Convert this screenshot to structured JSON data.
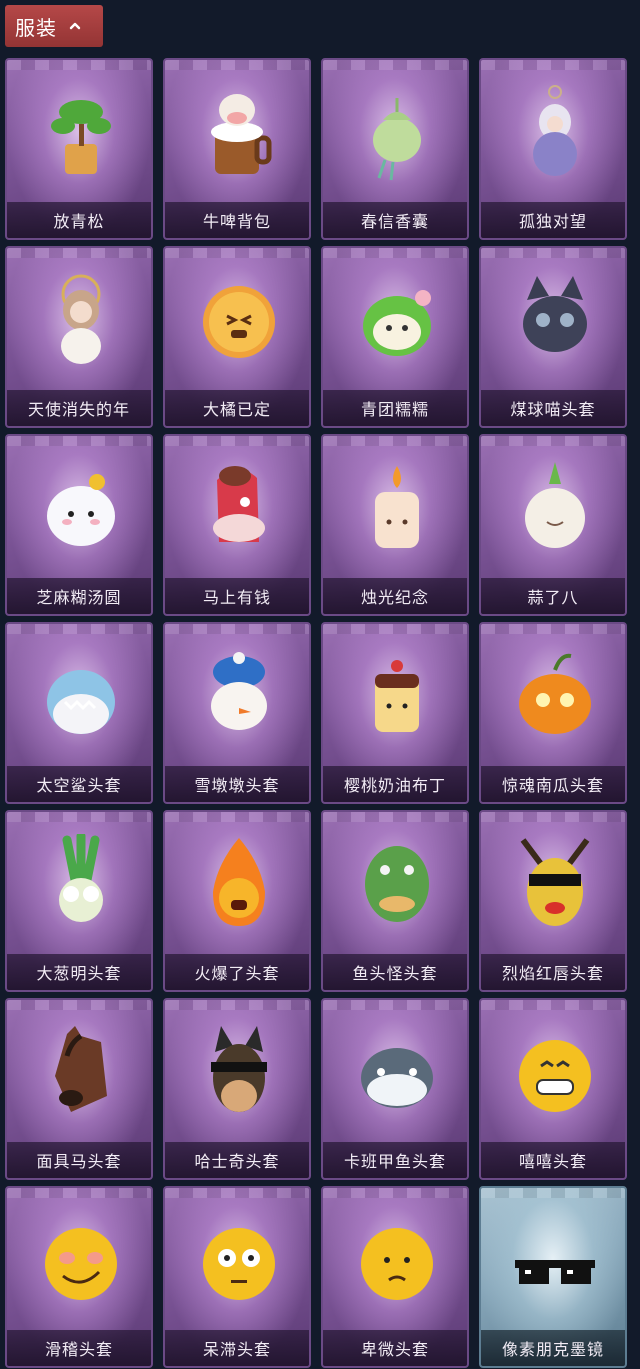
{
  "header": {
    "title": "服装",
    "chevron_icon": "chevron-up-icon",
    "color": "#a83e3e"
  },
  "items": [
    {
      "name": "放青松",
      "icon": "bonsai-tree-icon"
    },
    {
      "name": "牛啤背包",
      "icon": "cow-beer-mug-icon"
    },
    {
      "name": "春信香囊",
      "icon": "sachet-icon"
    },
    {
      "name": "孤独对望",
      "icon": "doll-keychain-icon"
    },
    {
      "name": "天使消失的年",
      "icon": "angel-doll-icon"
    },
    {
      "name": "大橘已定",
      "icon": "orange-slice-icon"
    },
    {
      "name": "青团糯糯",
      "icon": "green-rice-ball-icon"
    },
    {
      "name": "煤球喵头套",
      "icon": "black-cat-head-icon"
    },
    {
      "name": "芝麻糊汤圆",
      "icon": "tangyuan-icon"
    },
    {
      "name": "马上有钱",
      "icon": "red-horse-head-icon"
    },
    {
      "name": "烛光纪念",
      "icon": "candle-icon"
    },
    {
      "name": "蒜了八",
      "icon": "garlic-icon"
    },
    {
      "name": "太空鲨头套",
      "icon": "shark-head-icon"
    },
    {
      "name": "雪墩墩头套",
      "icon": "snowman-head-icon"
    },
    {
      "name": "樱桃奶油布丁",
      "icon": "pudding-icon"
    },
    {
      "name": "惊魂南瓜头套",
      "icon": "pumpkin-icon"
    },
    {
      "name": "大葱明头套",
      "icon": "scallion-head-icon"
    },
    {
      "name": "火爆了头套",
      "icon": "fire-head-icon"
    },
    {
      "name": "鱼头怪头套",
      "icon": "fish-mask-icon"
    },
    {
      "name": "烈焰红唇头套",
      "icon": "yellow-mask-sunglasses-icon"
    },
    {
      "name": "面具马头套",
      "icon": "horse-mask-icon"
    },
    {
      "name": "哈士奇头套",
      "icon": "husky-sunglasses-icon"
    },
    {
      "name": "卡班甲鱼头套",
      "icon": "fish-head-icon"
    },
    {
      "name": "嘻嘻头套",
      "icon": "grin-emoji-icon"
    },
    {
      "name": "滑稽头套",
      "icon": "smirk-emoji-icon"
    },
    {
      "name": "呆滞头套",
      "icon": "stare-emoji-icon"
    },
    {
      "name": "卑微头套",
      "icon": "humble-emoji-icon"
    },
    {
      "name": "像素朋克墨镜",
      "icon": "pixel-sunglasses-icon",
      "rarity": "blue"
    }
  ]
}
